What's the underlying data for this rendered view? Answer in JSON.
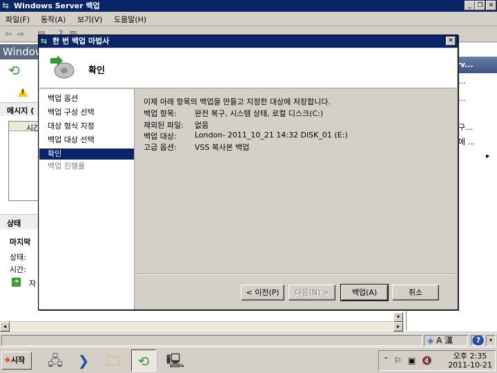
{
  "window": {
    "title": "Windows Server 백업"
  },
  "menu": [
    "파일(F)",
    "동작(A)",
    "보기(V)",
    "도움말(H)"
  ],
  "background": {
    "header_partial": "Windows",
    "left_labels": {
      "warn_row": "!",
      "message_header": "메시지 (",
      "col_time": "시간",
      "status_section": "상태",
      "last_row": "마지막 ",
      "status_label": "상태:",
      "time_label": "시간:",
      "link_partial": "자"
    },
    "right_pane": {
      "header": "erv...",
      "items": [
        "...",
        "...",
        "구...",
        "에 ...",
        "..."
      ]
    }
  },
  "dialog": {
    "title": "한 번 백업 마법사",
    "header_title": "확인",
    "nav": [
      {
        "label": "백업 옵션",
        "state": "normal"
      },
      {
        "label": "백업 구성 선택",
        "state": "normal"
      },
      {
        "label": "대상 형식 지정",
        "state": "normal"
      },
      {
        "label": "백업 대상 선택",
        "state": "normal"
      },
      {
        "label": "확인",
        "state": "selected"
      },
      {
        "label": "백업 진행률",
        "state": "disabled"
      }
    ],
    "intro": "이제 아래 항목의 백업을 만들고 지정한 대상에 저장합니다.",
    "details": [
      {
        "label": "백업 항목:",
        "value": "완전 복구, 시스템 상태, 로컬 디스크(C:)"
      },
      {
        "label": "제외된 파일:",
        "value": "없음"
      },
      {
        "label": "백업 대상:",
        "value": "London- 2011_10_21 14:32 DISK_01 (E:)"
      },
      {
        "label": "고급 옵션:",
        "value": "VSS 복사본 백업"
      }
    ],
    "buttons": {
      "prev": "< 이전(P)",
      "next": "다음(N) >",
      "backup": "백업(A)",
      "cancel": "취소"
    }
  },
  "statusbar": {
    "ime": "A 漢"
  },
  "taskbar": {
    "start": "시작",
    "time": "오후 2:35",
    "date": "2011-10-21"
  }
}
